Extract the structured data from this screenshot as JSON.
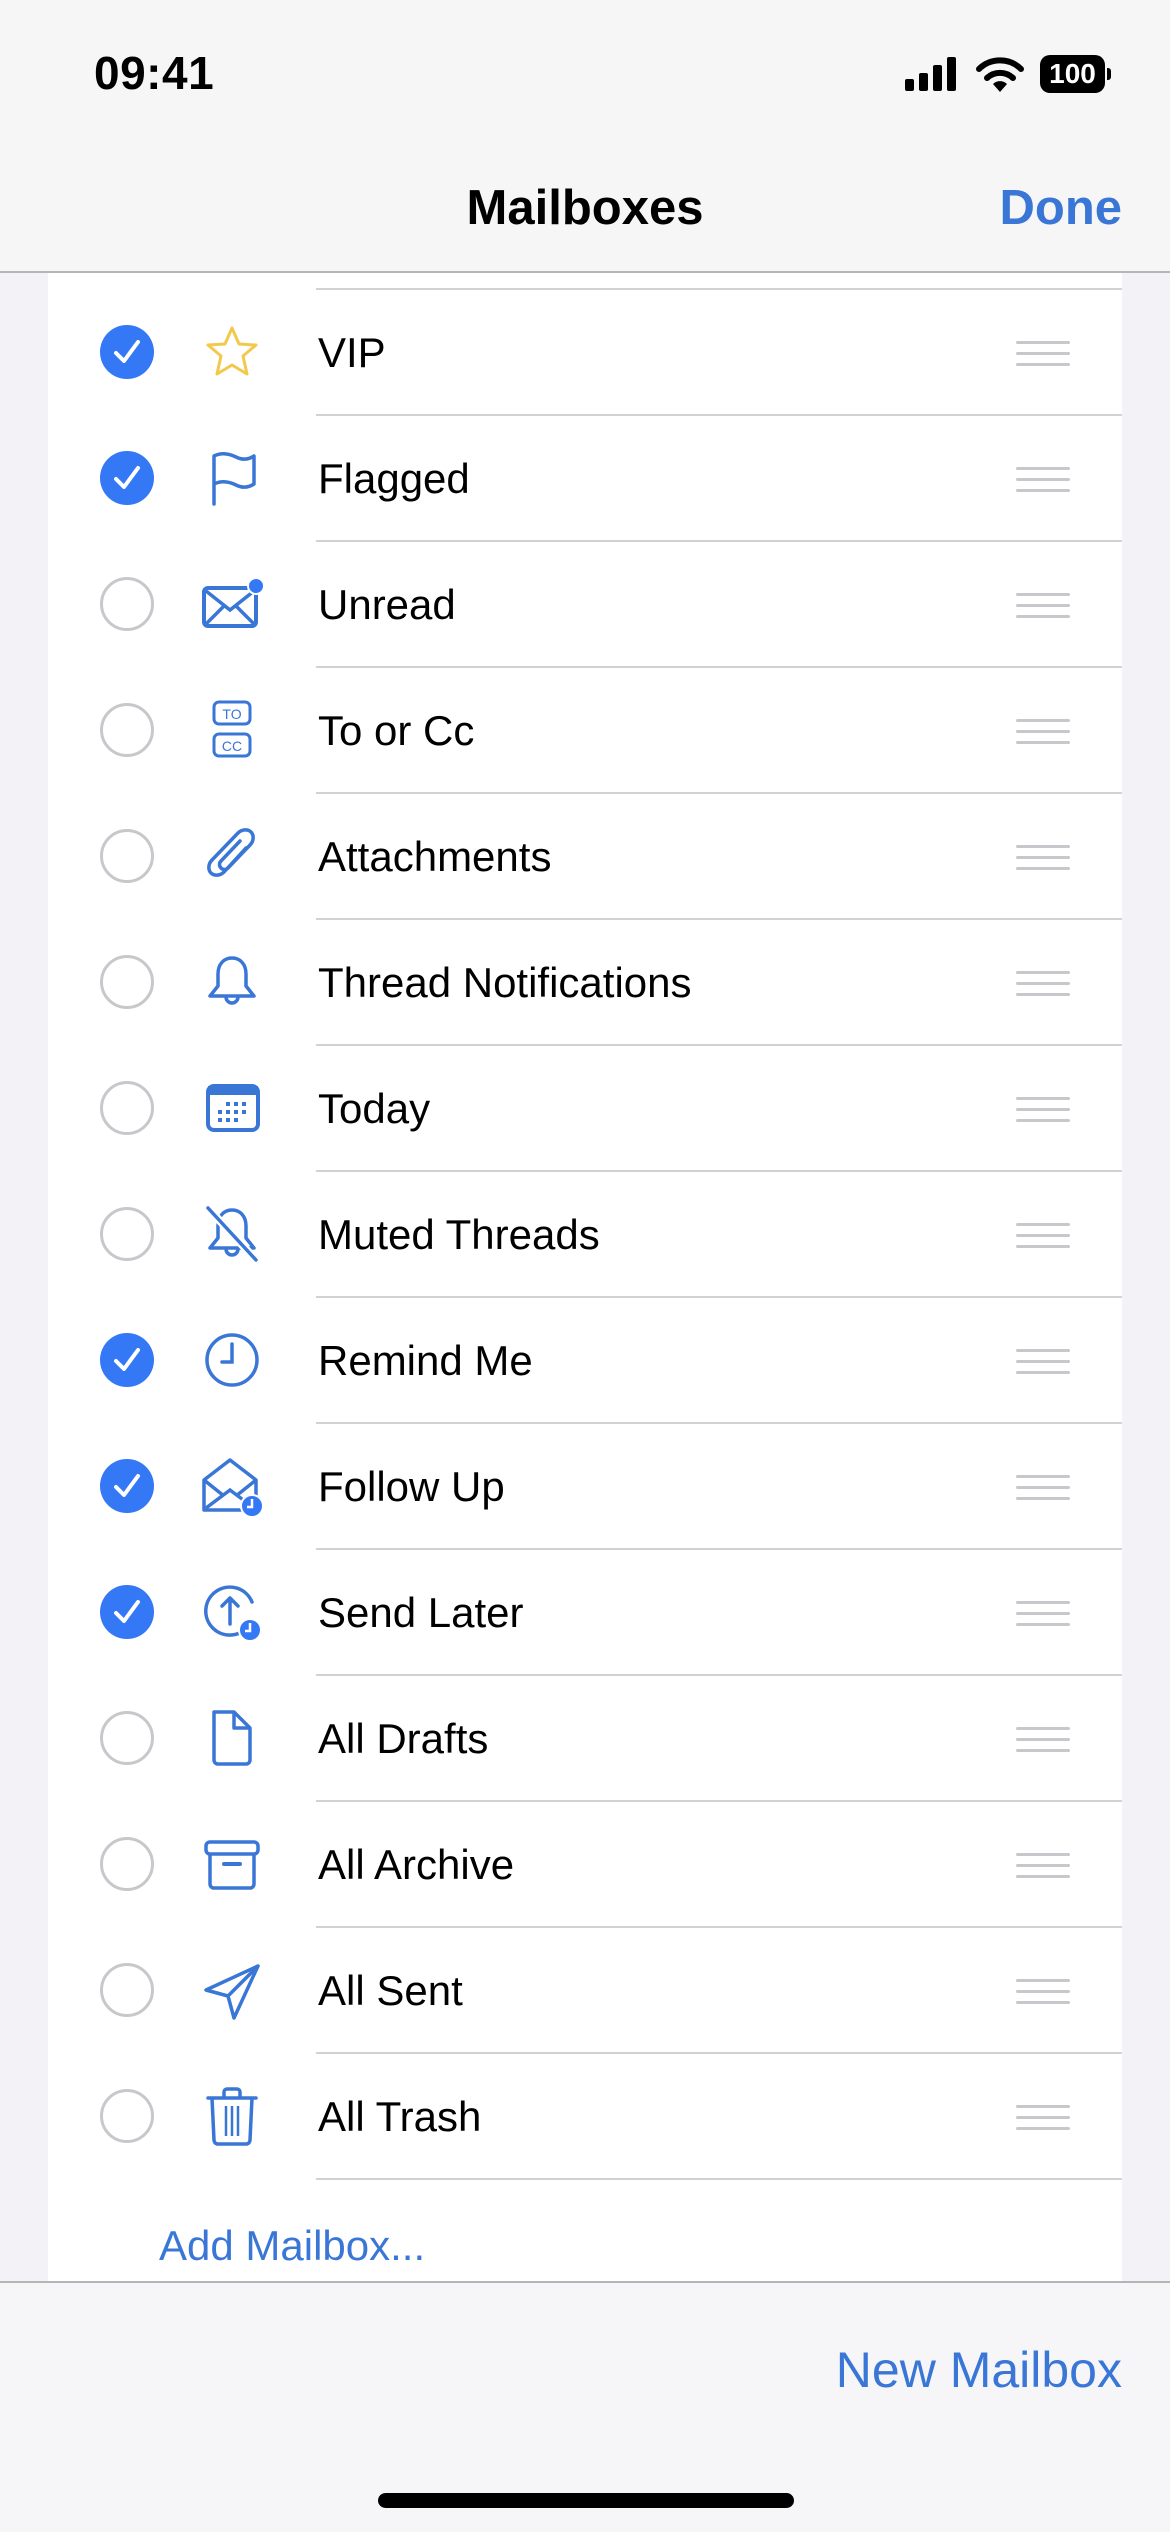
{
  "status_bar": {
    "time": "09:41",
    "battery_level": "100",
    "signal_bars": 4,
    "wifi": "full"
  },
  "nav": {
    "title": "Mailboxes",
    "done_label": "Done"
  },
  "colors": {
    "accent": "#3478F6",
    "link": "#3A76D6",
    "vip_star": "#F2C94C",
    "unchecked": "#C7C7CC"
  },
  "mailboxes": [
    {
      "label": "VIP",
      "checked": true,
      "icon": "star-icon"
    },
    {
      "label": "Flagged",
      "checked": true,
      "icon": "flag-icon"
    },
    {
      "label": "Unread",
      "checked": false,
      "icon": "unread-envelope-icon"
    },
    {
      "label": "To or Cc",
      "checked": false,
      "icon": "to-cc-icon"
    },
    {
      "label": "Attachments",
      "checked": false,
      "icon": "paperclip-icon"
    },
    {
      "label": "Thread Notifications",
      "checked": false,
      "icon": "bell-icon"
    },
    {
      "label": "Today",
      "checked": false,
      "icon": "calendar-icon"
    },
    {
      "label": "Muted Threads",
      "checked": false,
      "icon": "bell-slash-icon"
    },
    {
      "label": "Remind Me",
      "checked": true,
      "icon": "clock-icon"
    },
    {
      "label": "Follow Up",
      "checked": true,
      "icon": "envelope-open-clock-icon"
    },
    {
      "label": "Send Later",
      "checked": true,
      "icon": "send-later-icon"
    },
    {
      "label": "All Drafts",
      "checked": false,
      "icon": "document-icon"
    },
    {
      "label": "All Archive",
      "checked": false,
      "icon": "archive-box-icon"
    },
    {
      "label": "All Sent",
      "checked": false,
      "icon": "paperplane-icon"
    },
    {
      "label": "All Trash",
      "checked": false,
      "icon": "trash-icon"
    }
  ],
  "add_mailbox_label": "Add Mailbox...",
  "toolbar": {
    "new_mailbox_label": "New Mailbox"
  }
}
